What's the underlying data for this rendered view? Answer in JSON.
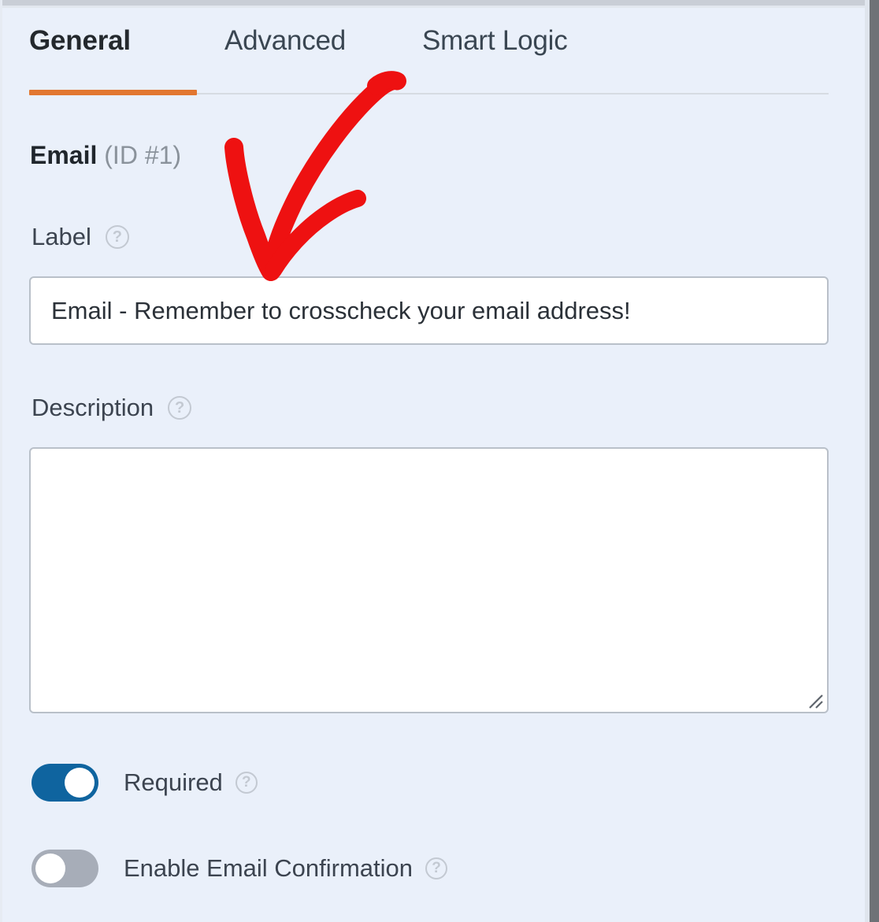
{
  "theme": {
    "background": "#eaf0fa",
    "accent_orange": "#e27730",
    "toggle_on_blue": "#0f649f",
    "toggle_off_gray": "#a7adb8",
    "annotation_red": "#ee1111",
    "text_dark": "#3c4450"
  },
  "tabs": [
    {
      "label": "General",
      "active": true
    },
    {
      "label": "Advanced",
      "active": false
    },
    {
      "label": "Smart Logic",
      "active": false
    }
  ],
  "field": {
    "type_name": "Email",
    "id_text": "(ID #1)"
  },
  "label_field": {
    "label": "Label",
    "help_icon": "question-mark-circle-icon",
    "value": "Email - Remember to crosscheck your email address!",
    "placeholder": ""
  },
  "description_field": {
    "label": "Description",
    "help_icon": "question-mark-circle-icon",
    "value": "",
    "placeholder": ""
  },
  "toggles": [
    {
      "label": "Required",
      "state": "on",
      "help_icon": "question-mark-circle-icon"
    },
    {
      "label": "Enable Email Confirmation",
      "state": "off",
      "help_icon": "question-mark-circle-icon"
    }
  ],
  "annotation": {
    "type": "hand-drawn-arrow",
    "color": "#ee1111",
    "points_to": "label-input"
  }
}
